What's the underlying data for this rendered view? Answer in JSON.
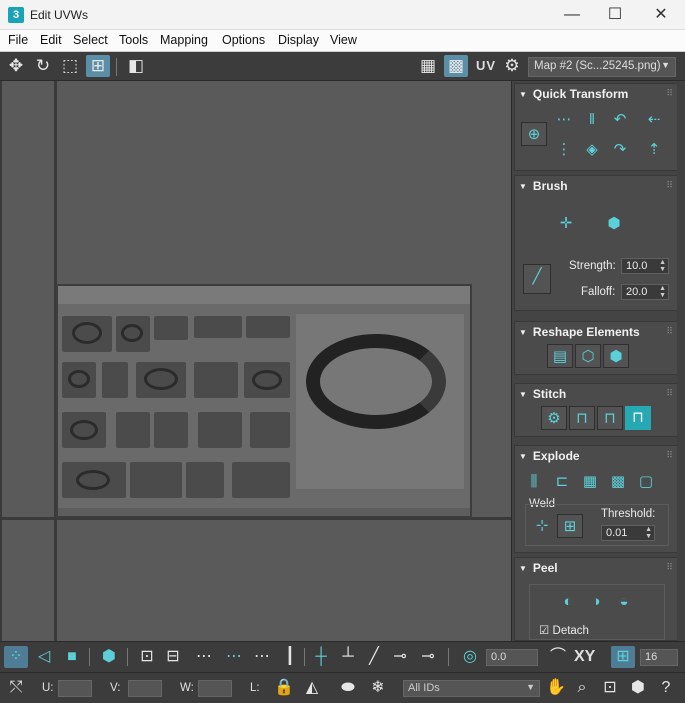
{
  "window": {
    "title": "Edit UVWs",
    "app_icon": "3",
    "minimize": "—",
    "maximize": "☐",
    "close": "✕"
  },
  "menu": [
    "File",
    "Edit",
    "Select",
    "Tools",
    "Mapping",
    "Options",
    "Display",
    "View"
  ],
  "toolbar": {
    "uv_label": "UV",
    "map_select": "Map #2 (Sc...25245.png)"
  },
  "panel": {
    "quick_transform": {
      "title": "Quick Transform"
    },
    "brush": {
      "title": "Brush",
      "strength_label": "Strength:",
      "strength_value": "10.0",
      "falloff_label": "Falloff:",
      "falloff_value": "20.0"
    },
    "reshape": {
      "title": "Reshape Elements"
    },
    "stitch": {
      "title": "Stitch"
    },
    "explode": {
      "title": "Explode",
      "weld_label": "Weld",
      "threshold_label": "Threshold:",
      "threshold_value": "0.01"
    },
    "peel": {
      "title": "Peel",
      "detach_label": "Detach",
      "detach_checked": true
    }
  },
  "bottom": {
    "angle_value": "0.0",
    "xy_label": "XY",
    "snap_value": "16",
    "u_label": "U:",
    "v_label": "V:",
    "w_label": "W:",
    "l_label": "L:",
    "ids_select": "All IDs"
  },
  "colors": {
    "accent": "#5cd0d8",
    "highlight": "#27a9b3",
    "panel_bg": "#444444",
    "viewport_bg": "#5a5a5a"
  }
}
